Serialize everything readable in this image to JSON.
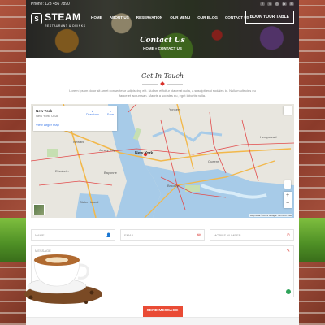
{
  "topbar": {
    "phone_label": "Phone: 123 456 7890",
    "social_icons": [
      "facebook-icon",
      "twitter-icon",
      "instagram-icon",
      "youtube-icon",
      "mail-icon"
    ]
  },
  "brand": {
    "mark": "S",
    "name": "STEAM",
    "tagline": "RESTAURANT & DRINKS"
  },
  "nav": {
    "items": [
      "HOME",
      "ABOUT US",
      "RESERVATION",
      "OUR MENU",
      "OUR BLOG",
      "CONTACT US"
    ]
  },
  "book_button": "BOOK YOUR TABLE",
  "hero": {
    "title": "Contact Us",
    "breadcrumb": "HOME » CONTACT US"
  },
  "section": {
    "title": "Get In Touch",
    "intro": "Lorem ipsum dolor sit amet consectetur adipiscing elit. Nullam efficitur placerat nulla, a suscipit erat sodales id. Nullam ultricies eu fauce et accumsan. Mauris a sodales eu, eget lobortis nulla."
  },
  "map": {
    "place_name": "New York",
    "place_address": "New York, USA",
    "larger_map_link": "View larger map",
    "directions_label": "Directions",
    "save_label": "Save",
    "labels": [
      "Newark",
      "Jersey City",
      "New York",
      "Brooklyn",
      "Queens",
      "Staten Island",
      "Bayonne",
      "Yonkers",
      "Elizabeth",
      "Hempstead"
    ],
    "footer": "Map data ©2019 Google  Terms of Use",
    "colors": {
      "water": "#a7cbe8",
      "land": "#e8e6df",
      "highway": "#f2b84b",
      "road": "#e24b4b"
    }
  },
  "form": {
    "name_placeholder": "NAME",
    "email_placeholder": "EMAIL",
    "mobile_placeholder": "MOBILE NUMBER",
    "message_placeholder": "MESSAGE",
    "send_label": "SEND MESSAGE"
  },
  "colors": {
    "accent": "#e94b35",
    "brick": "#9c4a36"
  }
}
